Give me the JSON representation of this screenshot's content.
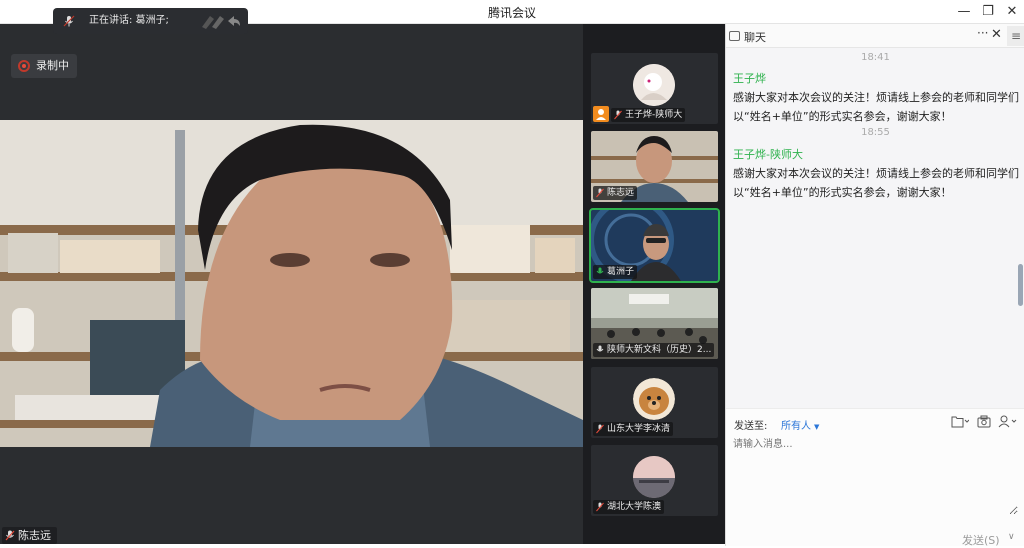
{
  "window": {
    "title": "腾讯会议"
  },
  "speaking": {
    "text": "正在讲话: 葛洲子;"
  },
  "recording": {
    "label": "录制中"
  },
  "main_video": {
    "participant": "陈志远"
  },
  "gallery": {
    "participants": [
      {
        "name": "王子烨-陕师大",
        "kind": "avatar",
        "host": true,
        "active": false
      },
      {
        "name": "陈志远",
        "kind": "video",
        "host": false,
        "active": false
      },
      {
        "name": "葛洲子",
        "kind": "video",
        "host": false,
        "active": true
      },
      {
        "name": "陕师大新文科（历史）2...",
        "kind": "video",
        "host": false,
        "active": false
      },
      {
        "name": "山东大学李冰清",
        "kind": "avatar",
        "host": false,
        "active": false
      },
      {
        "name": "湖北大学陈澳",
        "kind": "avatar",
        "host": false,
        "active": false
      }
    ]
  },
  "chat": {
    "title": "聊天",
    "messages": [
      {
        "time": "18:41",
        "sender": "王子烨",
        "line1": "感谢大家对本次会议的关注！烦请线上参会的老师和同学们",
        "line2": "以“姓名+单位”的形式实名参会，谢谢大家！"
      },
      {
        "time": "18:55",
        "sender": "王子烨-陕师大",
        "line1": "感谢大家对本次会议的关注！烦请线上参会的老师和同学们",
        "line2": "以“姓名+单位”的形式实名参会，谢谢大家！"
      }
    ],
    "send_to_label": "发送至:",
    "send_to_value": "所有人",
    "input_placeholder": "请输入消息...",
    "send_button": "发送(S)"
  },
  "colors": {
    "accent_green": "#2fb24e",
    "link_blue": "#2b76d8",
    "host_orange": "#f28c1f"
  }
}
